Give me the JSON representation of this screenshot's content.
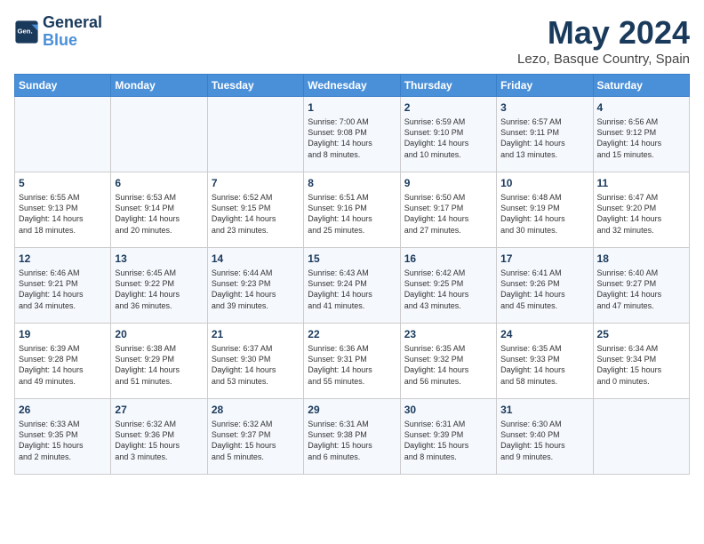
{
  "header": {
    "logo_line1": "General",
    "logo_line2": "Blue",
    "month_title": "May 2024",
    "location": "Lezo, Basque Country, Spain"
  },
  "calendar": {
    "days_of_week": [
      "Sunday",
      "Monday",
      "Tuesday",
      "Wednesday",
      "Thursday",
      "Friday",
      "Saturday"
    ],
    "weeks": [
      [
        {
          "day": "",
          "content": ""
        },
        {
          "day": "",
          "content": ""
        },
        {
          "day": "",
          "content": ""
        },
        {
          "day": "1",
          "content": "Sunrise: 7:00 AM\nSunset: 9:08 PM\nDaylight: 14 hours\nand 8 minutes."
        },
        {
          "day": "2",
          "content": "Sunrise: 6:59 AM\nSunset: 9:10 PM\nDaylight: 14 hours\nand 10 minutes."
        },
        {
          "day": "3",
          "content": "Sunrise: 6:57 AM\nSunset: 9:11 PM\nDaylight: 14 hours\nand 13 minutes."
        },
        {
          "day": "4",
          "content": "Sunrise: 6:56 AM\nSunset: 9:12 PM\nDaylight: 14 hours\nand 15 minutes."
        }
      ],
      [
        {
          "day": "5",
          "content": "Sunrise: 6:55 AM\nSunset: 9:13 PM\nDaylight: 14 hours\nand 18 minutes."
        },
        {
          "day": "6",
          "content": "Sunrise: 6:53 AM\nSunset: 9:14 PM\nDaylight: 14 hours\nand 20 minutes."
        },
        {
          "day": "7",
          "content": "Sunrise: 6:52 AM\nSunset: 9:15 PM\nDaylight: 14 hours\nand 23 minutes."
        },
        {
          "day": "8",
          "content": "Sunrise: 6:51 AM\nSunset: 9:16 PM\nDaylight: 14 hours\nand 25 minutes."
        },
        {
          "day": "9",
          "content": "Sunrise: 6:50 AM\nSunset: 9:17 PM\nDaylight: 14 hours\nand 27 minutes."
        },
        {
          "day": "10",
          "content": "Sunrise: 6:48 AM\nSunset: 9:19 PM\nDaylight: 14 hours\nand 30 minutes."
        },
        {
          "day": "11",
          "content": "Sunrise: 6:47 AM\nSunset: 9:20 PM\nDaylight: 14 hours\nand 32 minutes."
        }
      ],
      [
        {
          "day": "12",
          "content": "Sunrise: 6:46 AM\nSunset: 9:21 PM\nDaylight: 14 hours\nand 34 minutes."
        },
        {
          "day": "13",
          "content": "Sunrise: 6:45 AM\nSunset: 9:22 PM\nDaylight: 14 hours\nand 36 minutes."
        },
        {
          "day": "14",
          "content": "Sunrise: 6:44 AM\nSunset: 9:23 PM\nDaylight: 14 hours\nand 39 minutes."
        },
        {
          "day": "15",
          "content": "Sunrise: 6:43 AM\nSunset: 9:24 PM\nDaylight: 14 hours\nand 41 minutes."
        },
        {
          "day": "16",
          "content": "Sunrise: 6:42 AM\nSunset: 9:25 PM\nDaylight: 14 hours\nand 43 minutes."
        },
        {
          "day": "17",
          "content": "Sunrise: 6:41 AM\nSunset: 9:26 PM\nDaylight: 14 hours\nand 45 minutes."
        },
        {
          "day": "18",
          "content": "Sunrise: 6:40 AM\nSunset: 9:27 PM\nDaylight: 14 hours\nand 47 minutes."
        }
      ],
      [
        {
          "day": "19",
          "content": "Sunrise: 6:39 AM\nSunset: 9:28 PM\nDaylight: 14 hours\nand 49 minutes."
        },
        {
          "day": "20",
          "content": "Sunrise: 6:38 AM\nSunset: 9:29 PM\nDaylight: 14 hours\nand 51 minutes."
        },
        {
          "day": "21",
          "content": "Sunrise: 6:37 AM\nSunset: 9:30 PM\nDaylight: 14 hours\nand 53 minutes."
        },
        {
          "day": "22",
          "content": "Sunrise: 6:36 AM\nSunset: 9:31 PM\nDaylight: 14 hours\nand 55 minutes."
        },
        {
          "day": "23",
          "content": "Sunrise: 6:35 AM\nSunset: 9:32 PM\nDaylight: 14 hours\nand 56 minutes."
        },
        {
          "day": "24",
          "content": "Sunrise: 6:35 AM\nSunset: 9:33 PM\nDaylight: 14 hours\nand 58 minutes."
        },
        {
          "day": "25",
          "content": "Sunrise: 6:34 AM\nSunset: 9:34 PM\nDaylight: 15 hours\nand 0 minutes."
        }
      ],
      [
        {
          "day": "26",
          "content": "Sunrise: 6:33 AM\nSunset: 9:35 PM\nDaylight: 15 hours\nand 2 minutes."
        },
        {
          "day": "27",
          "content": "Sunrise: 6:32 AM\nSunset: 9:36 PM\nDaylight: 15 hours\nand 3 minutes."
        },
        {
          "day": "28",
          "content": "Sunrise: 6:32 AM\nSunset: 9:37 PM\nDaylight: 15 hours\nand 5 minutes."
        },
        {
          "day": "29",
          "content": "Sunrise: 6:31 AM\nSunset: 9:38 PM\nDaylight: 15 hours\nand 6 minutes."
        },
        {
          "day": "30",
          "content": "Sunrise: 6:31 AM\nSunset: 9:39 PM\nDaylight: 15 hours\nand 8 minutes."
        },
        {
          "day": "31",
          "content": "Sunrise: 6:30 AM\nSunset: 9:40 PM\nDaylight: 15 hours\nand 9 minutes."
        },
        {
          "day": "",
          "content": ""
        }
      ]
    ]
  }
}
